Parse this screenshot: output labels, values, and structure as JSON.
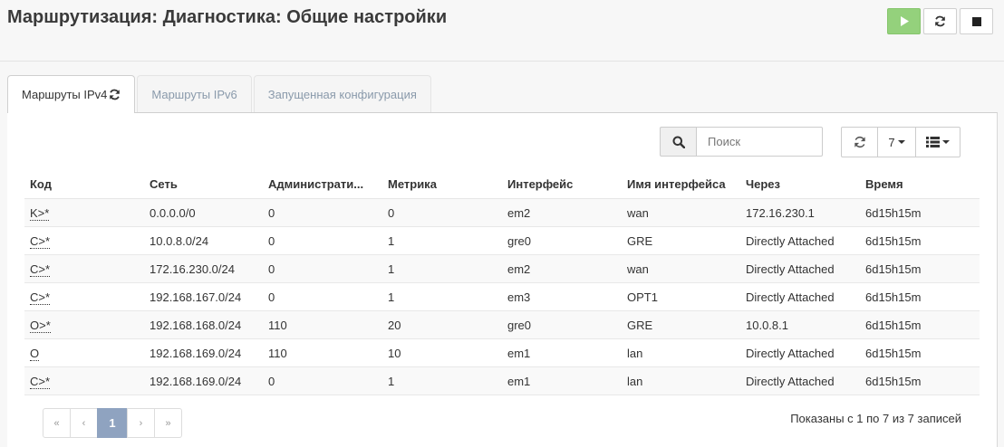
{
  "header": {
    "title": "Маршрутизация: Диагностика: Общие настройки",
    "colors": {
      "play": "#94d17c"
    }
  },
  "tabs": [
    {
      "label": "Маршруты IPv4",
      "icon": "refresh-icon"
    },
    {
      "label": "Маршруты IPv6"
    },
    {
      "label": "Запущенная конфигурация"
    }
  ],
  "toolbar": {
    "search_placeholder": "Поиск",
    "page_size": "7"
  },
  "table": {
    "columns": [
      "Код",
      "Сеть",
      "Администрати...",
      "Метрика",
      "Интерфейс",
      "Имя интерфейса",
      "Через",
      "Время"
    ],
    "rows": [
      [
        "K>*",
        "0.0.0.0/0",
        "0",
        "0",
        "em2",
        "wan",
        "172.16.230.1",
        "6d15h15m"
      ],
      [
        "C>*",
        "10.0.8.0/24",
        "0",
        "1",
        "gre0",
        "GRE",
        "Directly Attached",
        "6d15h15m"
      ],
      [
        "C>*",
        "172.16.230.0/24",
        "0",
        "1",
        "em2",
        "wan",
        "Directly Attached",
        "6d15h15m"
      ],
      [
        "C>*",
        "192.168.167.0/24",
        "0",
        "1",
        "em3",
        "OPT1",
        "Directly Attached",
        "6d15h15m"
      ],
      [
        "O>*",
        "192.168.168.0/24",
        "110",
        "20",
        "gre0",
        "GRE",
        "10.0.8.1",
        "6d15h15m"
      ],
      [
        "O",
        "192.168.169.0/24",
        "110",
        "10",
        "em1",
        "lan",
        "Directly Attached",
        "6d15h15m"
      ],
      [
        "C>*",
        "192.168.169.0/24",
        "0",
        "1",
        "em1",
        "lan",
        "Directly Attached",
        "6d15h15m"
      ]
    ]
  },
  "pagination": {
    "first": "«",
    "prev": "‹",
    "current": "1",
    "next": "›",
    "last": "»",
    "info": "Показаны с 1 по 7 из 7 записей",
    "active_color": "#8fa3c0"
  }
}
